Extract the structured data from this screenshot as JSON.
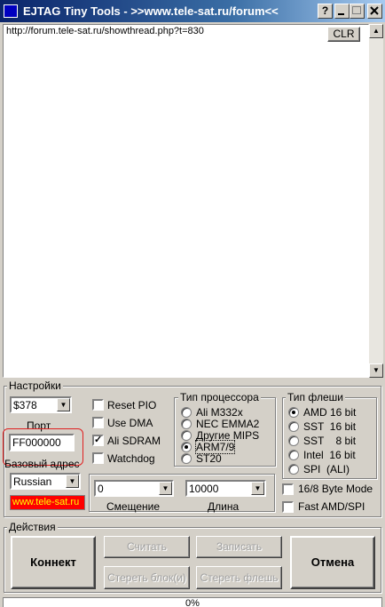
{
  "window": {
    "title": "EJTAG Tiny Tools - >>www.tele-sat.ru/forum<<",
    "help_label": "?"
  },
  "log": {
    "text": "http://forum.tele-sat.ru/showthread.php?t=830",
    "clear_label": "CLR"
  },
  "settings": {
    "group_label": "Настройки",
    "port_value": "$378",
    "port_label": "Порт",
    "base_address_value": "FF000000",
    "base_address_label": "Базовый адрес",
    "language_value": "Russian",
    "link_text": "www.tele-sat.ru",
    "link_bg": "#ff0000",
    "link_color": "#ffff00",
    "checkboxes": [
      {
        "label": "Reset PIO",
        "checked": false
      },
      {
        "label": "Use DMA",
        "checked": false
      },
      {
        "label": "Ali SDRAM",
        "checked": true
      },
      {
        "label": "Watchdog",
        "checked": false
      }
    ],
    "cpu_group_label": "Тип процессора",
    "cpu_options": [
      {
        "label": "Ali M332x",
        "selected": false
      },
      {
        "label": "NEC EMMA2",
        "selected": false
      },
      {
        "label": "Другие MIPS",
        "selected": false
      },
      {
        "label": "ARM7/9",
        "selected": true
      },
      {
        "label": "ST20",
        "selected": false
      }
    ],
    "flash_group_label": "Тип флеши",
    "flash_options": [
      {
        "label": "AMD 16 bit",
        "selected": true
      },
      {
        "label": "SST  16 bit",
        "selected": false
      },
      {
        "label": "SST    8 bit",
        "selected": false
      },
      {
        "label": "Intel  16 bit",
        "selected": false
      },
      {
        "label": "SPI  (ALI)",
        "selected": false
      }
    ],
    "offset_value": "0",
    "offset_label": "Смещение",
    "length_value": "10000",
    "length_label": "Длина",
    "byte_mode_label": "16/8 Byte Mode",
    "fast_label": "Fast AMD/SPI"
  },
  "actions": {
    "group_label": "Действия",
    "connect_label": "Коннект",
    "read_label": "Считать",
    "write_label": "Записать",
    "erase_block_label": "Стереть блок(и)",
    "erase_flash_label": "Стереть флешь",
    "cancel_label": "Отмена"
  },
  "progress": {
    "text": "0%",
    "value": 0
  }
}
